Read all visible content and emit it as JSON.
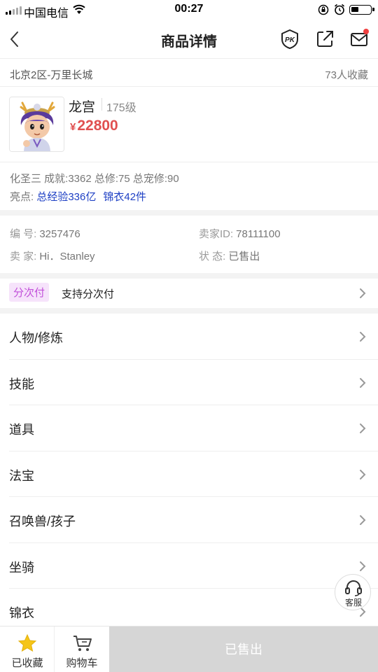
{
  "status_bar": {
    "carrier": "中国电信",
    "time": "00:27"
  },
  "header": {
    "title": "商品详情",
    "icons": [
      "back-arrow-icon",
      "pk-icon",
      "share-icon",
      "mail-icon"
    ]
  },
  "server": {
    "name": "北京2区-万里长城",
    "favorites": "73人收藏"
  },
  "product": {
    "role_name": "龙宫",
    "level": "175级",
    "currency": "¥",
    "price": "22800",
    "attributes": "化圣三 成就:3362 总修:75 总宠修:90",
    "highlight_label": "亮点:",
    "highlights": [
      "总经验336亿",
      "锦衣42件"
    ]
  },
  "info": {
    "id_label": "编 号:",
    "id_value": "3257476",
    "seller_id_label": "卖家ID:",
    "seller_id_value": "78111100",
    "seller_label": "卖 家:",
    "seller_value": "Hi．Stanley",
    "status_label": "状 态:",
    "status_value": "已售出"
  },
  "installment": {
    "badge": "分次付",
    "text": "支持分次付"
  },
  "menu": {
    "items": [
      {
        "label": "人物/修炼"
      },
      {
        "label": "技能"
      },
      {
        "label": "道具"
      },
      {
        "label": "法宝"
      },
      {
        "label": "召唤兽/孩子"
      },
      {
        "label": "坐骑"
      },
      {
        "label": "锦衣"
      }
    ]
  },
  "service": {
    "label": "客服"
  },
  "bottom_bar": {
    "favorited_label": "已收藏",
    "cart_label": "购物车",
    "sold_label": "已售出"
  },
  "colors": {
    "price": "#e05050",
    "highlight": "#1d3fc4",
    "badge_bg": "#f6e3fb",
    "badge_text": "#c14fd9",
    "star": "#f5c518",
    "sold_button": "#d6d6d6"
  }
}
